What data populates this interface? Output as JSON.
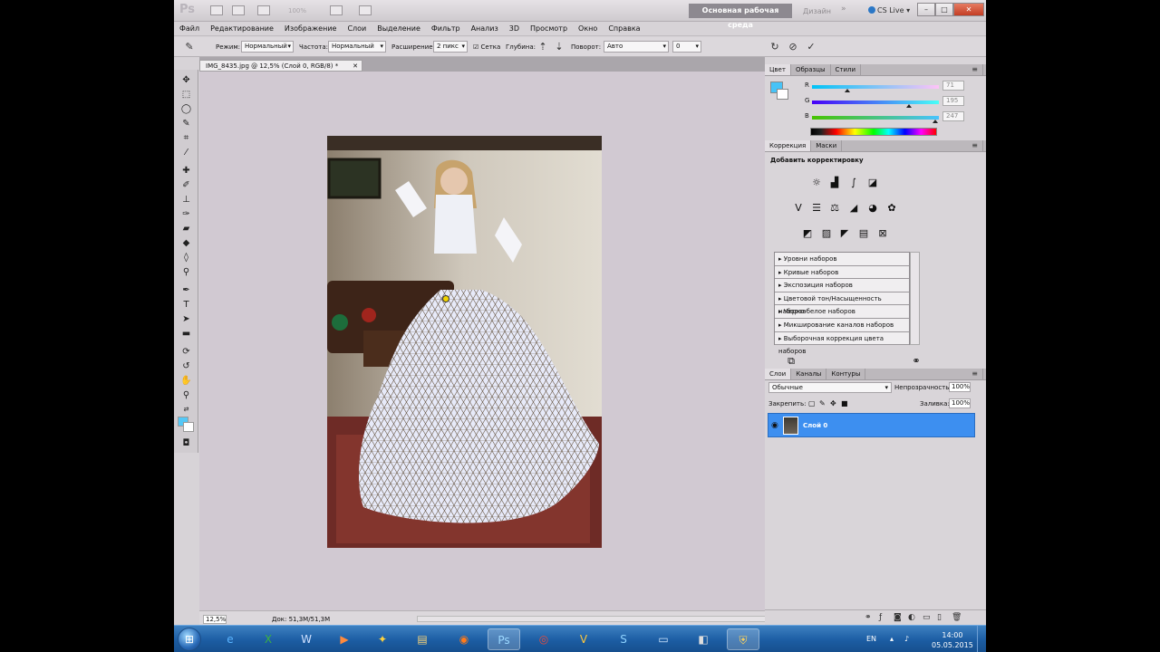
{
  "app": {
    "logo": "Ps",
    "zoom_display": "100%",
    "workspace_active": "Основная рабочая среда",
    "workspace_design": "Дизайн",
    "workspace_more": "»",
    "cs_live": "CS Live"
  },
  "menu": [
    "Файл",
    "Редактирование",
    "Изображение",
    "Слои",
    "Выделение",
    "Фильтр",
    "Анализ",
    "3D",
    "Просмотр",
    "Окно",
    "Справка"
  ],
  "options": {
    "mode_label": "Режим:",
    "mode_value": "Нормальный",
    "density_label": "Частота:",
    "density_value": "Нормальный",
    "expand_label": "Расширение:",
    "expand_value": "2 пикс",
    "mesh_label": "Сетка",
    "depth_label": "Глубина:",
    "rotate_label": "Поворот:",
    "rotate_value": "Авто",
    "angle_value": "0"
  },
  "document": {
    "tab_title": "IMG_8435.jpg @ 12,5% (Слой 0, RGB/8) *",
    "status_zoom": "12,5%",
    "status_doc": "Док: 51,3М/51,3М"
  },
  "color_panel": {
    "tabs": [
      "Цвет",
      "Образцы",
      "Стили"
    ],
    "r_label": "R",
    "r_value": "71",
    "r_level": 0.278,
    "g_label": "G",
    "g_value": "195",
    "g_level": 0.765,
    "b_label": "B",
    "b_value": "247",
    "b_level": 0.969,
    "fg_color": "#47c3f7"
  },
  "adjustments": {
    "tabs": [
      "Коррекция",
      "Маски"
    ],
    "title": "Добавить корректировку",
    "presets": [
      "Уровни наборов",
      "Кривые наборов",
      "Экспозиция наборов",
      "Цветовой тон/Насыщенность наборов",
      "Черно-белое наборов",
      "Микширование каналов наборов",
      "Выборочная коррекция цвета наборов"
    ]
  },
  "layers": {
    "tabs": [
      "Слои",
      "Каналы",
      "Контуры"
    ],
    "blend_mode": "Обычные",
    "opacity_label": "Непрозрачность:",
    "opacity_value": "100%",
    "lock_label": "Закрепить:",
    "fill_label": "Заливка:",
    "fill_value": "100%",
    "layer_name": "Слой 0"
  },
  "taskbar": {
    "lang": "EN",
    "time": "14:00",
    "date": "05.05.2015"
  }
}
